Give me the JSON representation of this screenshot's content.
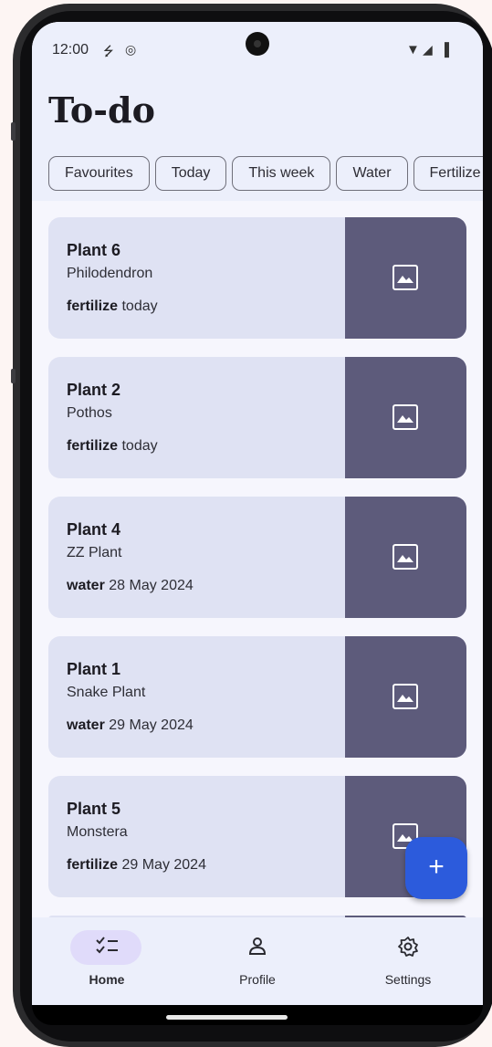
{
  "status": {
    "time": "12:00"
  },
  "header": {
    "title": "To-do"
  },
  "filters": [
    "Favourites",
    "Today",
    "This week",
    "Water",
    "Fertilize"
  ],
  "plants": [
    {
      "name": "Plant 6",
      "species": "Philodendron",
      "task": "fertilize",
      "due": "today"
    },
    {
      "name": "Plant 2",
      "species": "Pothos",
      "task": "fertilize",
      "due": "today"
    },
    {
      "name": "Plant 4",
      "species": "ZZ Plant",
      "task": "water",
      "due": "28 May 2024"
    },
    {
      "name": "Plant 1",
      "species": "Snake Plant",
      "task": "water",
      "due": "29 May 2024"
    },
    {
      "name": "Plant 5",
      "species": "Monstera",
      "task": "fertilize",
      "due": "29 May 2024"
    }
  ],
  "fab": {
    "label": "+"
  },
  "nav": [
    {
      "label": "Home",
      "icon": "checklist-icon",
      "active": true
    },
    {
      "label": "Profile",
      "icon": "person-icon",
      "active": false
    },
    {
      "label": "Settings",
      "icon": "gear-icon",
      "active": false
    }
  ],
  "colors": {
    "accent": "#2c5bdc",
    "card": "#dfe2f3",
    "image_placeholder": "#5d5b7b",
    "header": "#eceffb"
  }
}
